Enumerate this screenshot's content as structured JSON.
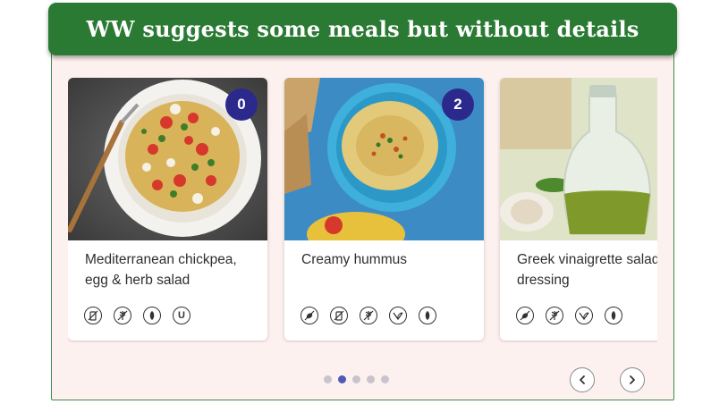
{
  "banner": {
    "text": "WW suggests some meals but without details"
  },
  "carousel": {
    "cards": [
      {
        "title_line1": "Mediterranean chickpea,",
        "title_line2": "egg & herb salad",
        "badge": "0",
        "icons": [
          "no-dairy-icon",
          "no-gluten-icon",
          "no-nuts-icon",
          "u-icon"
        ]
      },
      {
        "title_line1": "Creamy hummus",
        "title_line2": "",
        "badge": "2",
        "icons": [
          "no-meat-icon",
          "no-dairy-icon",
          "no-gluten-icon",
          "vegan-icon",
          "no-nuts-icon"
        ]
      },
      {
        "title_line1": "Greek vinaigrette salad",
        "title_line2": "dressing",
        "badge": "",
        "icons": [
          "no-meat-icon",
          "no-gluten-icon",
          "vegan-icon",
          "no-nuts-icon"
        ]
      }
    ],
    "pagination": {
      "count": 5,
      "active_index": 1
    },
    "u_icon_letter": "U"
  },
  "colors": {
    "banner": "#2b7a34",
    "badge": "#2b2a8c",
    "panel": "#fdf1ef",
    "active_dot": "#5358b8"
  }
}
